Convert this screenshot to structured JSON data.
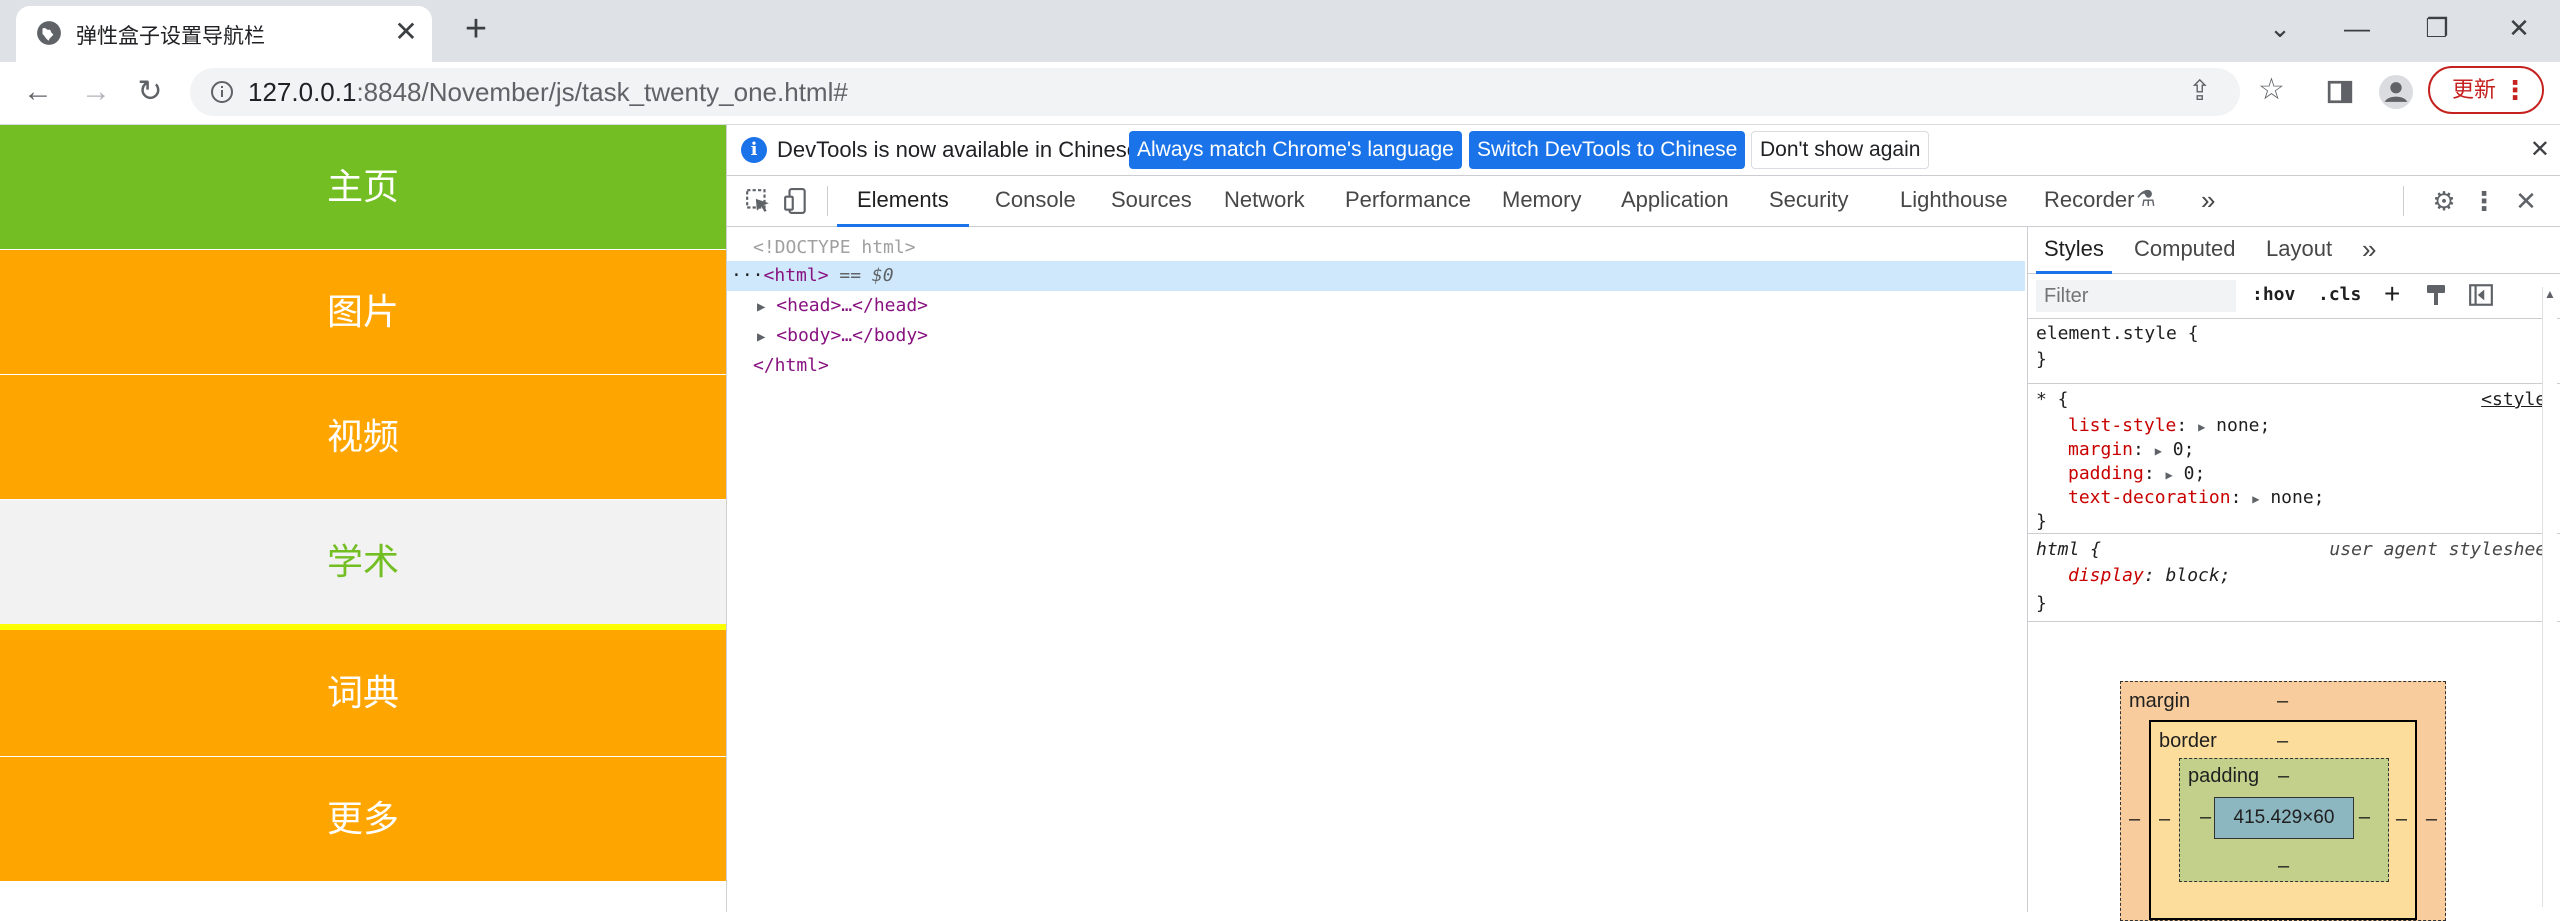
{
  "browser": {
    "tab_title": "弹性盒子设置导航栏",
    "tab_close": "✕",
    "new_tab": "+",
    "url_host": "127.0.0.1",
    "url_rest": ":8848/November/js/task_twenty_one.html#",
    "update_label": "更新",
    "window_controls": [
      "⌄",
      "—",
      "❐",
      "✕"
    ]
  },
  "page": {
    "nav_items": [
      {
        "label": "主页",
        "bg": "#73bf23",
        "color": "#ffffff"
      },
      {
        "label": "图片",
        "bg": "#ffa500",
        "color": "#ffffff"
      },
      {
        "label": "视频",
        "bg": "#ffa500",
        "color": "#ffffff"
      },
      {
        "label": "学术",
        "bg": "#f2f2f2",
        "color": "#73bf23"
      },
      {
        "label": "词典",
        "bg": "#ffa500",
        "color": "#ffffff"
      },
      {
        "label": "更多",
        "bg": "#ffa500",
        "color": "#ffffff"
      }
    ],
    "hover_indicator_color": "#ffff00"
  },
  "devtools": {
    "banner": {
      "message": "DevTools is now available in Chinese!",
      "btn_match": "Always match Chrome's language",
      "btn_switch": "Switch DevTools to Chinese",
      "btn_dismiss": "Don't show again"
    },
    "tabs": [
      "Elements",
      "Console",
      "Sources",
      "Network",
      "Performance",
      "Memory",
      "Application",
      "Security",
      "Lighthouse",
      "Recorder"
    ],
    "more_tabs": "»",
    "dom": {
      "doctype": "<!DOCTYPE html>",
      "html_open": "<html>",
      "html_selected_suffix": "== $0",
      "head": "<head>…</head>",
      "body": "<body>…</body>",
      "html_close": "</html>"
    },
    "styles": {
      "tabs": [
        "Styles",
        "Computed",
        "Layout"
      ],
      "more": "»",
      "filter_placeholder": "Filter",
      "hov": ":hov",
      "cls": ".cls",
      "element_style": "element.style {",
      "close_brace": "}",
      "star_selector": "* {",
      "star_source": "<style>",
      "star_props": [
        {
          "name": "list-style",
          "value": "none;"
        },
        {
          "name": "margin",
          "value": "0;"
        },
        {
          "name": "padding",
          "value": "0;"
        },
        {
          "name": "text-decoration",
          "value": "none;"
        }
      ],
      "html_selector": "html {",
      "html_source": "user agent stylesheet",
      "html_prop": "display",
      "html_value": "block;"
    },
    "box_model": {
      "margin_label": "margin",
      "border_label": "border",
      "padding_label": "padding",
      "content_size": "415.429×60",
      "dash": "–"
    }
  }
}
